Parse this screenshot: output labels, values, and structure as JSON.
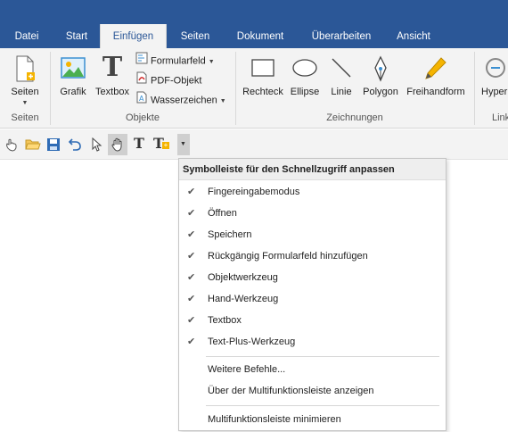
{
  "tabs": [
    {
      "label": "Datei"
    },
    {
      "label": "Start"
    },
    {
      "label": "Einfügen"
    },
    {
      "label": "Seiten"
    },
    {
      "label": "Dokument"
    },
    {
      "label": "Überarbeiten"
    },
    {
      "label": "Ansicht"
    }
  ],
  "active_tab": "Einfügen",
  "ribbon": {
    "groups": {
      "seiten": {
        "label": "Seiten",
        "button": "Seiten"
      },
      "objekte": {
        "label": "Objekte",
        "grafik": "Grafik",
        "textbox": "Textbox",
        "formularfeld": "Formularfeld",
        "pdf_objekt": "PDF-Objekt",
        "wasserzeichen": "Wasserzeichen"
      },
      "zeichnungen": {
        "label": "Zeichnungen",
        "rechteck": "Rechteck",
        "ellipse": "Ellipse",
        "linie": "Linie",
        "polygon": "Polygon",
        "freihandform": "Freihandform"
      },
      "links": {
        "label": "Link",
        "hyper": "Hyper"
      }
    }
  },
  "quick_access": {
    "icons": [
      "finger-icon",
      "folder-open-icon",
      "save-icon",
      "undo-icon",
      "select-arrow-icon",
      "hand-icon",
      "text-icon",
      "text-plus-icon",
      "customize-dropdown-icon"
    ]
  },
  "menu": {
    "title": "Symbolleiste für den Schnellzugriff anpassen",
    "items": [
      {
        "label": "Fingereingabemodus",
        "checked": "✔"
      },
      {
        "label": "Öffnen",
        "checked": "✔"
      },
      {
        "label": "Speichern",
        "checked": "✔"
      },
      {
        "label": "Rückgängig Formularfeld hinzufügen",
        "checked": "✔"
      },
      {
        "label": "Objektwerkzeug",
        "checked": "✔"
      },
      {
        "label": "Hand-Werkzeug",
        "checked": "✔"
      },
      {
        "label": "Textbox",
        "checked": "✔"
      },
      {
        "label": "Text-Plus-Werkzeug",
        "checked": "✔"
      }
    ],
    "more_commands": "Weitere Befehle...",
    "show_above": "Über der Multifunktionsleiste anzeigen",
    "minimize": "Multifunktionsleiste minimieren"
  },
  "colors": {
    "tab_bar": "#2b5797",
    "ribbon_bg": "#f3f3f3"
  }
}
